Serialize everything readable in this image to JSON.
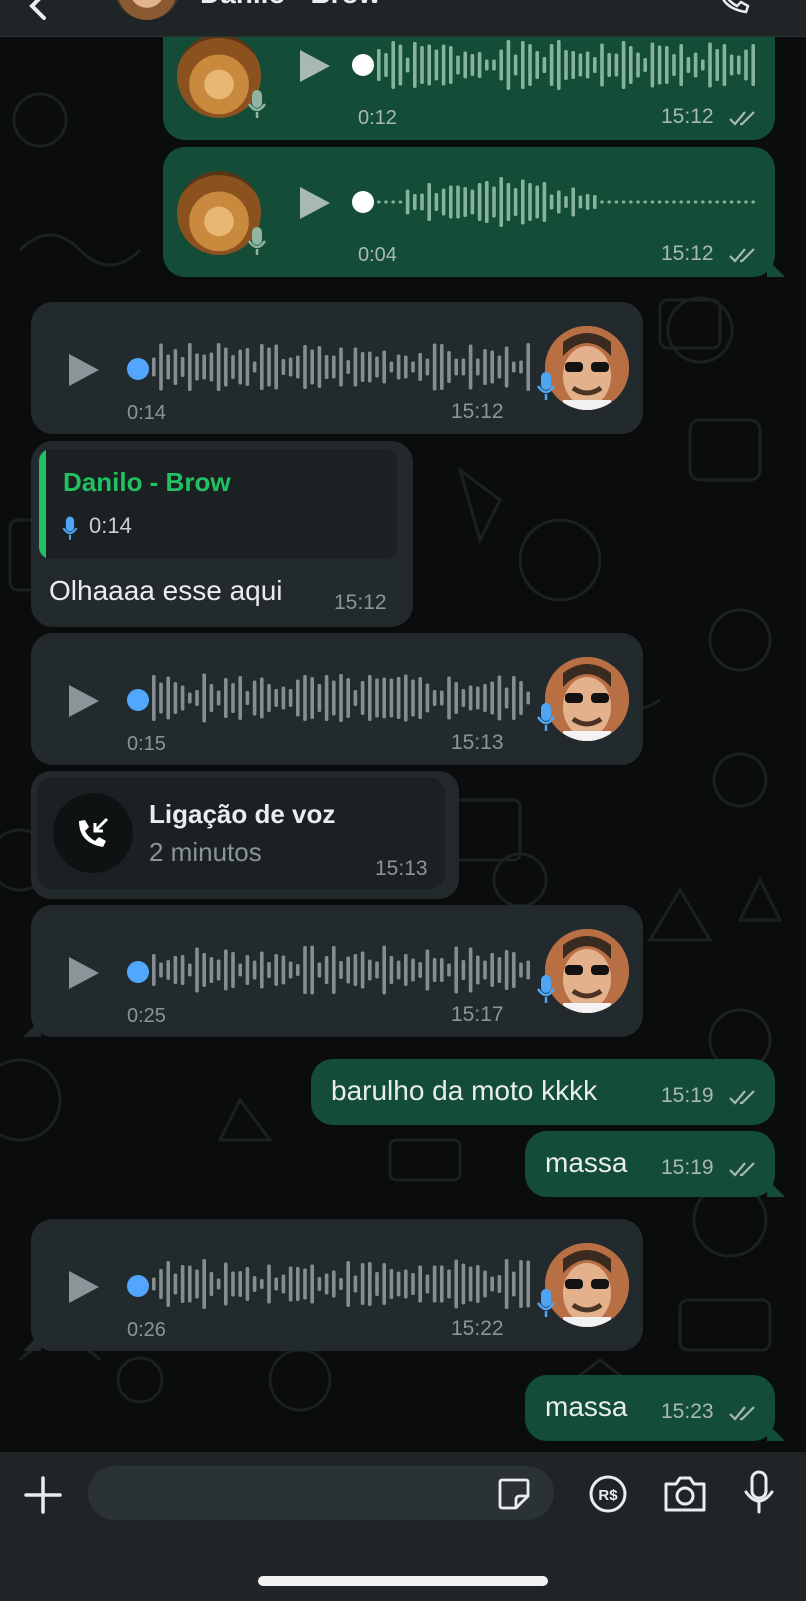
{
  "header": {
    "contact_name": "Danilo - Brow"
  },
  "messages": [
    {
      "kind": "voice-out",
      "duration": "0:12",
      "time": "15:12"
    },
    {
      "kind": "voice-out",
      "duration": "0:04",
      "time": "15:12"
    },
    {
      "kind": "voice-in",
      "duration": "0:14",
      "time": "15:12"
    },
    {
      "kind": "reply-in",
      "quote_name": "Danilo - Brow",
      "quote_duration": "0:14",
      "text": "Olhaaaa esse aqui",
      "time": "15:12"
    },
    {
      "kind": "voice-in",
      "duration": "0:15",
      "time": "15:13"
    },
    {
      "kind": "call-in",
      "title": "Ligação de voz",
      "subtitle": "2 minutos",
      "time": "15:13"
    },
    {
      "kind": "voice-in",
      "duration": "0:25",
      "time": "15:17"
    },
    {
      "kind": "text-out",
      "text": "barulho da moto kkkk",
      "time": "15:19"
    },
    {
      "kind": "text-out",
      "text": "massa",
      "time": "15:19"
    },
    {
      "kind": "voice-in",
      "duration": "0:26",
      "time": "15:22"
    },
    {
      "kind": "text-out",
      "text": "massa",
      "time": "15:23"
    }
  ],
  "composer": {
    "placeholder": ""
  },
  "icons": {
    "attach": "plus-icon",
    "sticker": "sticker-icon",
    "payment": "rs-payment-icon",
    "camera": "camera-icon",
    "mic": "microphone-icon",
    "read": "double-check-icon"
  },
  "colors": {
    "outgoing_bubble": "#144d37",
    "incoming_bubble": "#232a2d",
    "accent_green": "#21c063",
    "unplayed_blue": "#53a6fd",
    "mic_blue": "#4ea5f4"
  }
}
